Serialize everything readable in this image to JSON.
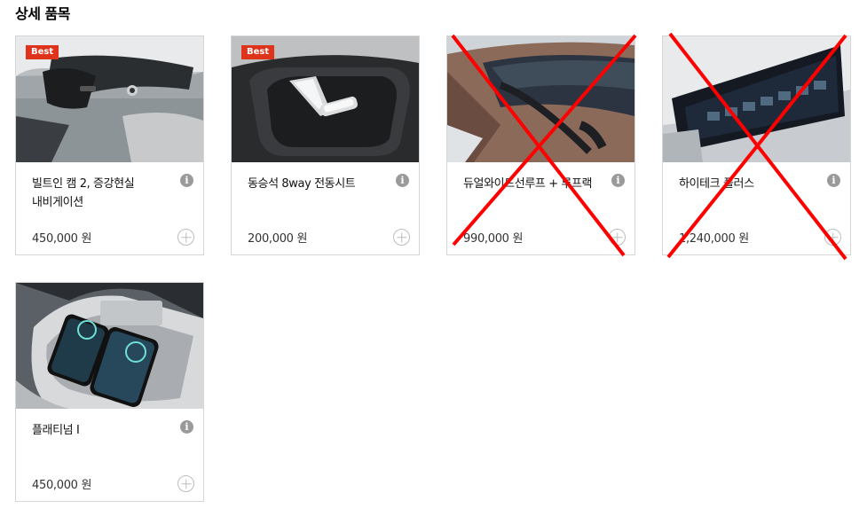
{
  "section": {
    "title": "상세 품목"
  },
  "items": [
    {
      "name": "빌트인 캠 2, 증강현실 내비게이션",
      "price": "450,000 원",
      "badge": "Best",
      "image": "builtin-cam-photo",
      "unavailable": false
    },
    {
      "name": "동승석 8way 전동시트",
      "price": "200,000 원",
      "badge": "Best",
      "image": "seat-control-photo",
      "unavailable": false
    },
    {
      "name": "듀얼와이드선루프 + 루프랙",
      "price": "990,000 원",
      "badge": "",
      "image": "sunroof-photo",
      "unavailable": true
    },
    {
      "name": "하이테크 플러스",
      "price": "1,240,000 원",
      "badge": "",
      "image": "display-panel-photo",
      "unavailable": true
    },
    {
      "name": "플래티넘 I",
      "price": "450,000 원",
      "badge": "",
      "image": "wireless-charger-photo",
      "unavailable": false
    }
  ],
  "icons": {
    "info": "info-icon",
    "add": "plus-circle-icon"
  },
  "colors": {
    "badge": "#e0331b",
    "cross": "#ff0000",
    "border": "#d6d6d6"
  }
}
